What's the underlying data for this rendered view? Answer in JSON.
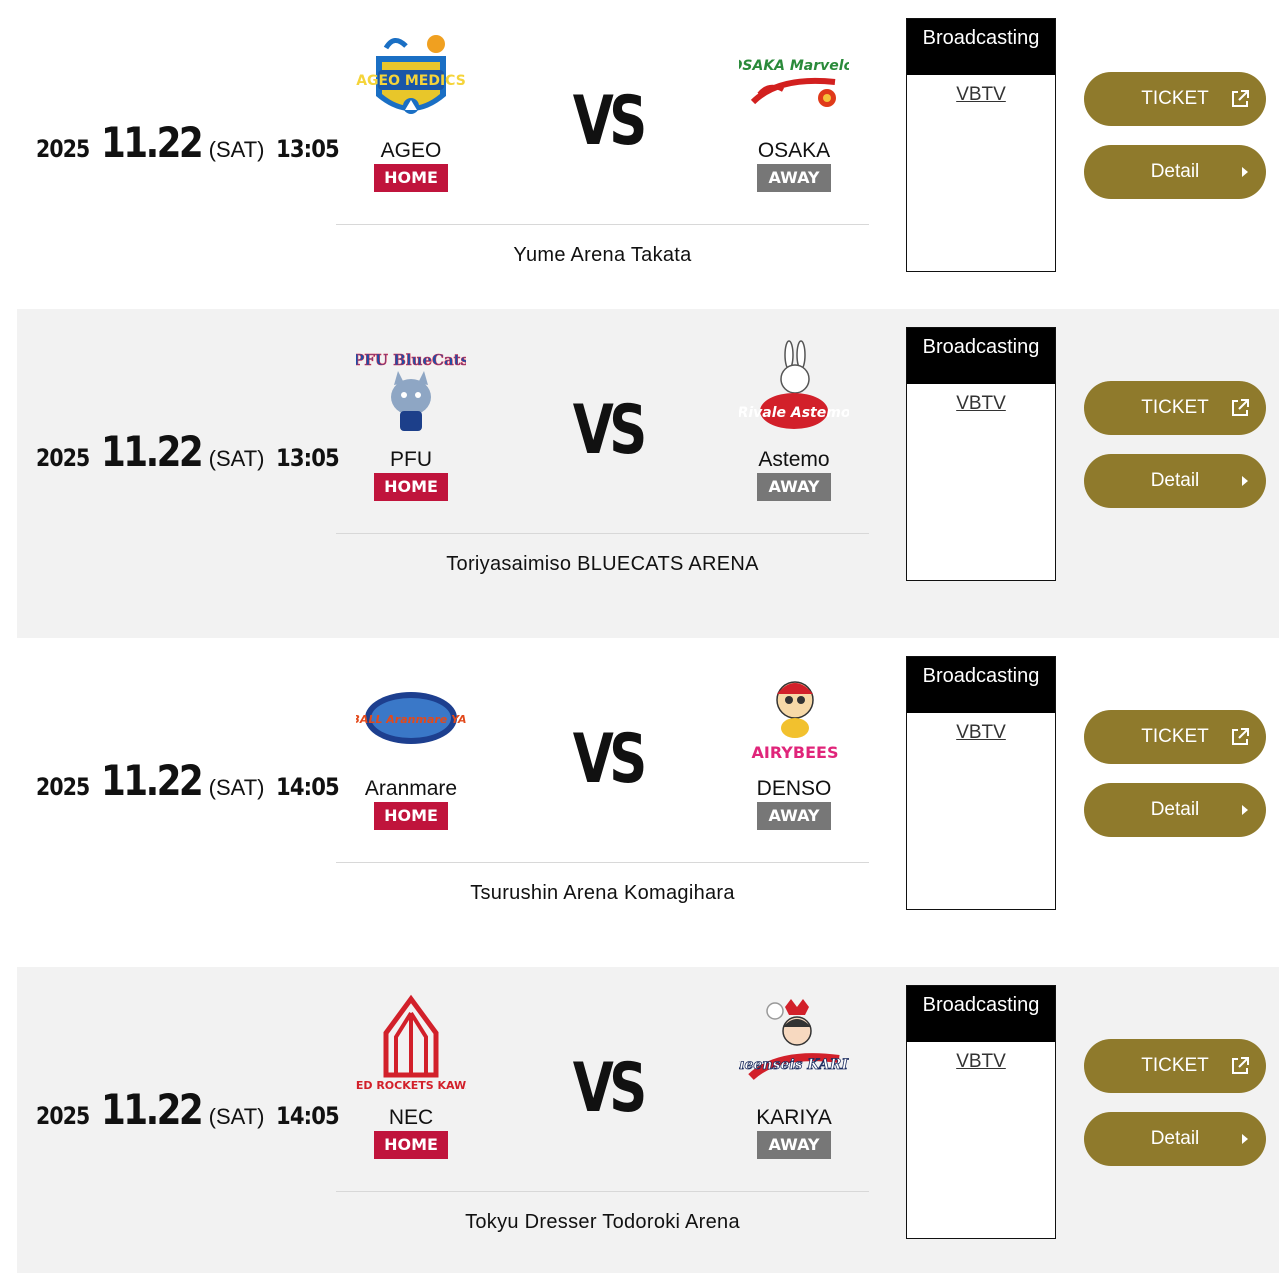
{
  "labels": {
    "vs": "VS",
    "home": "HOME",
    "away": "AWAY",
    "broadcasting": "Broadcasting",
    "ticket": "TICKET",
    "detail": "Detail"
  },
  "colors": {
    "home_badge": "#c0143c",
    "away_badge": "#777777",
    "button_gold": "#8f7a2c",
    "alt_row": "#f2f2f2"
  },
  "matches": [
    {
      "year": "2025",
      "month_day": "11.22",
      "weekday": "(SAT)",
      "time": "13:05",
      "home": {
        "name": "AGEO",
        "logo_text": "AGEO MEDICS",
        "logo_icon": "ageo-medics-logo"
      },
      "away": {
        "name": "OSAKA",
        "logo_text": "OSAKA Marvelous",
        "logo_icon": "osaka-marvelous-logo"
      },
      "venue": "Yume Arena Takata",
      "broadcast": [
        "VBTV"
      ]
    },
    {
      "year": "2025",
      "month_day": "11.22",
      "weekday": "(SAT)",
      "time": "13:05",
      "home": {
        "name": "PFU",
        "logo_text": "PFU BlueCats",
        "logo_icon": "pfu-bluecats-logo"
      },
      "away": {
        "name": "Astemo",
        "logo_text": "Rivale Astemo",
        "logo_icon": "astemo-rivale-logo"
      },
      "venue": "Toriyasaimiso BLUECATS ARENA",
      "broadcast": [
        "VBTV"
      ]
    },
    {
      "year": "2025",
      "month_day": "11.22",
      "weekday": "(SAT)",
      "time": "14:05",
      "home": {
        "name": "Aranmare",
        "logo_text": "VOLLEYBALL Aranmare YAMAGATA",
        "logo_icon": "aranmare-logo"
      },
      "away": {
        "name": "DENSO",
        "logo_text": "AIRYBEES",
        "logo_icon": "denso-airybees-logo"
      },
      "venue": "Tsurushin Arena Komagihara",
      "broadcast": [
        "VBTV"
      ]
    },
    {
      "year": "2025",
      "month_day": "11.22",
      "weekday": "(SAT)",
      "time": "14:05",
      "home": {
        "name": "NEC",
        "logo_text": "NEC RED ROCKETS KAWASAKI",
        "logo_icon": "nec-red-rockets-logo"
      },
      "away": {
        "name": "KARIYA",
        "logo_text": "Queenseis KARIYA",
        "logo_icon": "kariya-queenseis-logo"
      },
      "venue": "Tokyu Dresser Todoroki Arena",
      "broadcast": [
        "VBTV"
      ]
    }
  ]
}
